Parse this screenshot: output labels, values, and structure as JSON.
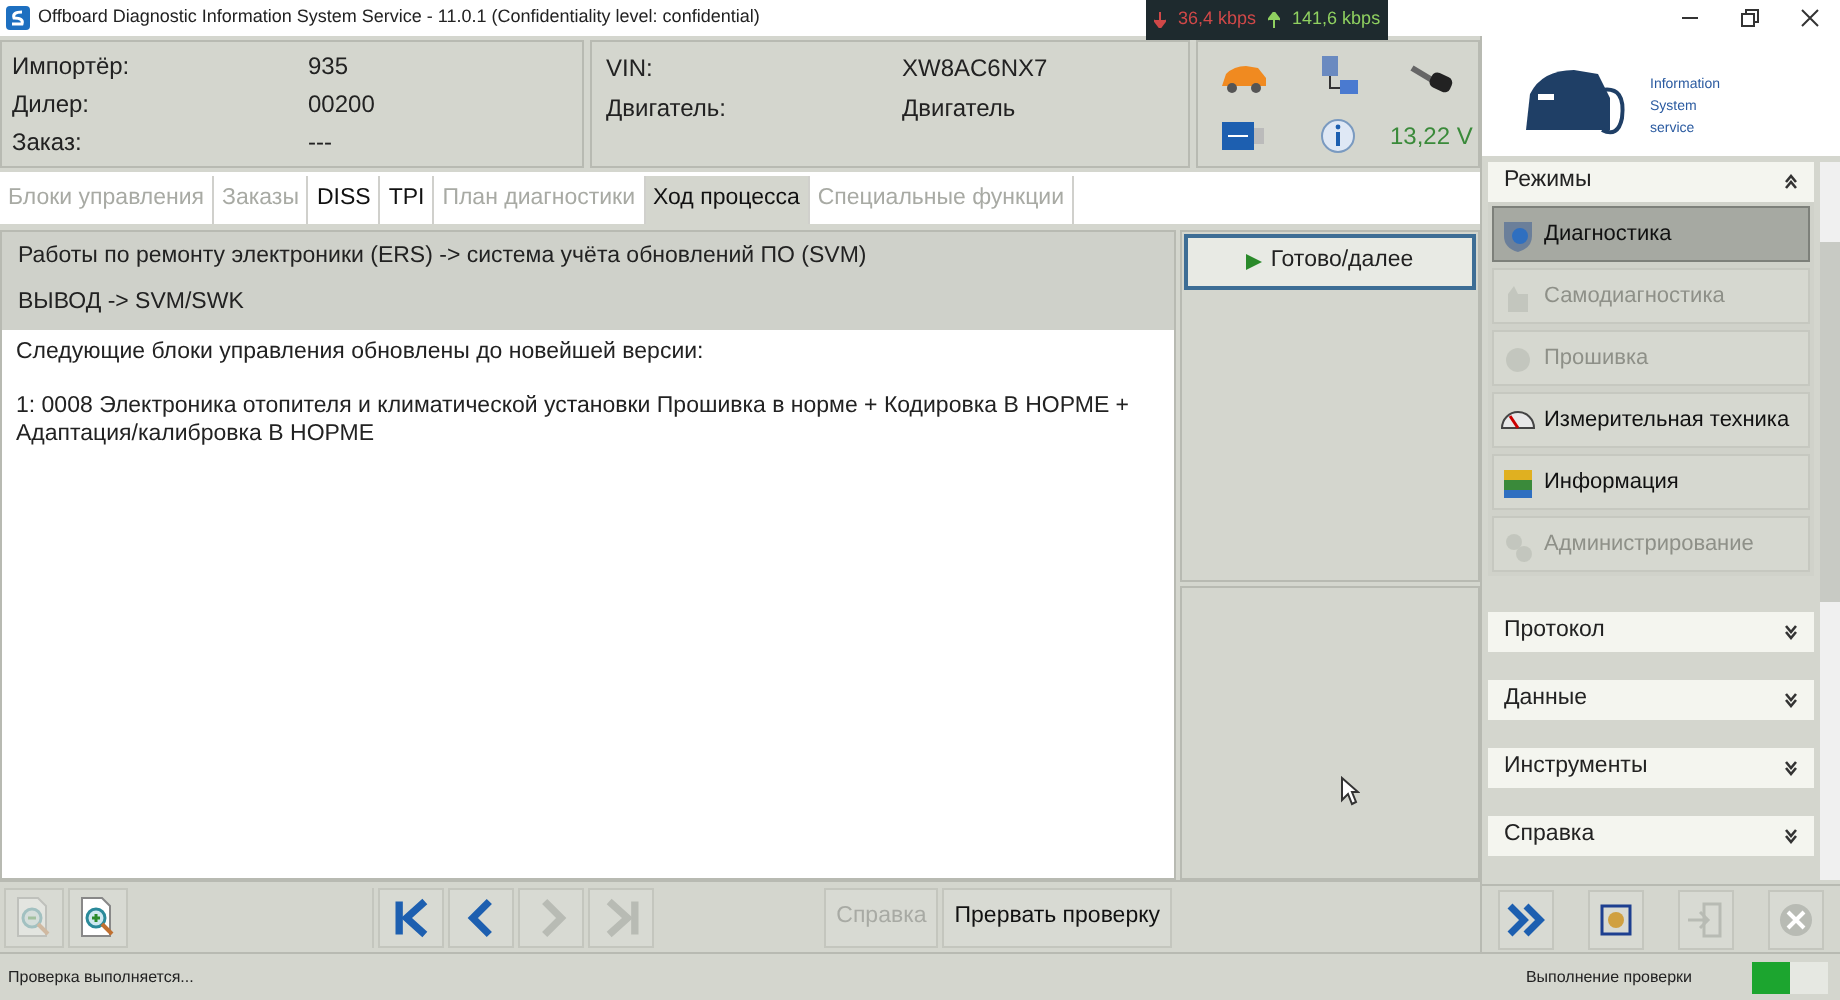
{
  "window": {
    "title": "Offboard Diagnostic Information System Service - 11.0.1 (Confidentiality level: confidential)"
  },
  "network_monitor": {
    "download": "36,4 kbps",
    "upload": "141,6 kbps"
  },
  "header": {
    "fields": [
      {
        "label": "Импортёр:",
        "value": "935"
      },
      {
        "label": "Дилер:",
        "value": "00200"
      },
      {
        "label": "Заказ:",
        "value": "---"
      }
    ],
    "vehicle": [
      {
        "label": "VIN:",
        "value": "XW8AC6NX7"
      },
      {
        "label": "Двигатель:",
        "value": "Двигатель"
      }
    ],
    "voltage": "13,22 V"
  },
  "logo": {
    "lines": [
      "Information",
      "System",
      "service"
    ]
  },
  "tabs": [
    {
      "label": "Блоки управления",
      "selected": false,
      "disabled": true
    },
    {
      "label": "Заказы",
      "selected": false,
      "disabled": true
    },
    {
      "label": "DISS",
      "selected": false,
      "disabled": false
    },
    {
      "label": "TPI",
      "selected": false,
      "disabled": false
    },
    {
      "label": "План диагностики",
      "selected": false,
      "disabled": true
    },
    {
      "label": "Ход процесса",
      "selected": true,
      "disabled": false
    },
    {
      "label": "Специальные функции",
      "selected": false,
      "disabled": true
    }
  ],
  "breadcrumb": [
    "Работы по ремонту электроники (ERS) -> система учёта обновлений ПО (SVM)",
    "ВЫВОД -> SVM/SWK"
  ],
  "message": [
    "Следующие блоки управления обновлены до новейшей версии:",
    "1: 0008 Электроника отопителя и климатической установки Прошивка в норме + Кодировка В НОРМЕ + Адаптация/калибровка В НОРМЕ"
  ],
  "next_button": {
    "label": "Готово/далее"
  },
  "zoom_tools": [
    {
      "kind": "zoom-out",
      "disabled": true
    },
    {
      "kind": "zoom-in",
      "disabled": false
    }
  ],
  "navigation": [
    {
      "kind": "first",
      "disabled": false
    },
    {
      "kind": "back",
      "disabled": false
    },
    {
      "kind": "forward",
      "disabled": true
    },
    {
      "kind": "last",
      "disabled": true
    }
  ],
  "actions": [
    {
      "label": "Справка",
      "disabled": true
    },
    {
      "label": "Прервать проверку",
      "disabled": false
    }
  ],
  "modes": {
    "title": "Режимы",
    "expanded": true,
    "items": [
      {
        "kind": "diagnosis",
        "label": "Диагностика",
        "selected": true,
        "disabled": false
      },
      {
        "kind": "self-diagnosis",
        "label": "Самодиагностика",
        "selected": false,
        "disabled": true
      },
      {
        "kind": "flash",
        "label": "Прошивка",
        "selected": false,
        "disabled": true
      },
      {
        "kind": "measure",
        "label": "Измерительная техника",
        "selected": false,
        "disabled": false
      },
      {
        "kind": "info",
        "label": "Информация",
        "selected": false,
        "disabled": false
      },
      {
        "kind": "admin",
        "label": "Администрирование",
        "selected": false,
        "disabled": true
      }
    ]
  },
  "sections": [
    {
      "title": "Протокол",
      "expanded": false
    },
    {
      "title": "Данные",
      "expanded": false
    },
    {
      "title": "Инструменты",
      "expanded": false
    },
    {
      "title": "Справка",
      "expanded": false
    }
  ],
  "sidebar_tools": [
    {
      "kind": "forward",
      "disabled": false
    },
    {
      "kind": "screenshot",
      "disabled": false
    },
    {
      "kind": "exit",
      "disabled": true
    },
    {
      "kind": "cancel",
      "disabled": true
    }
  ],
  "status_bar": {
    "text": "Проверка выполняется...",
    "progress_label": "Выполнение проверки",
    "level": 0.5
  }
}
